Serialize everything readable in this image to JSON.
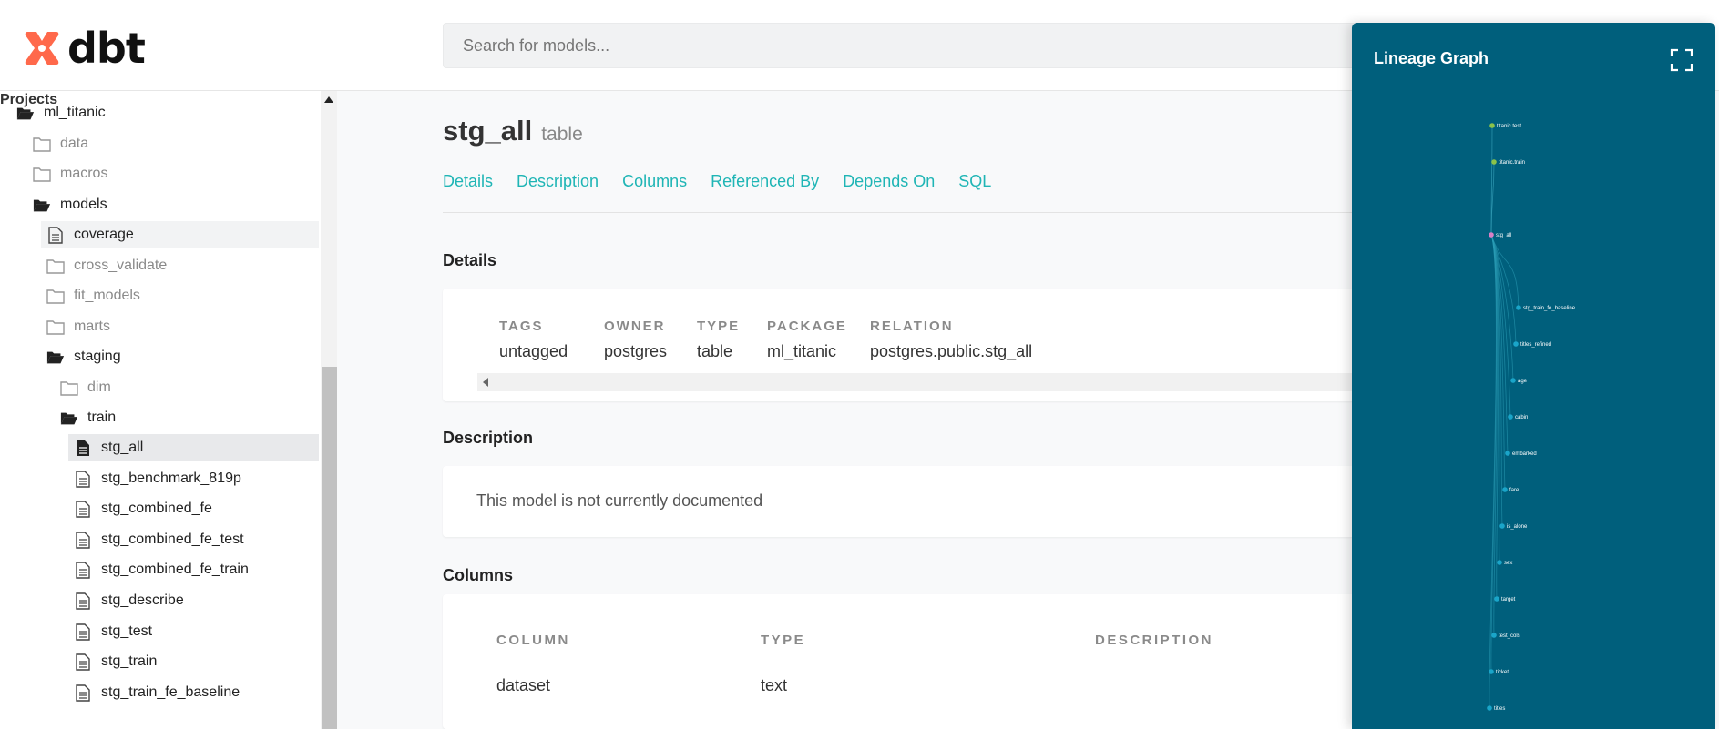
{
  "header": {
    "logo_text": "dbt",
    "search_placeholder": "Search for models..."
  },
  "sidebar": {
    "projects_title": "Projects",
    "items": [
      {
        "label": "ml_titanic",
        "icon": "folder-open-icon"
      },
      {
        "label": "data",
        "icon": "folder-icon"
      },
      {
        "label": "macros",
        "icon": "folder-icon"
      },
      {
        "label": "models",
        "icon": "folder-open-icon"
      },
      {
        "label": "coverage",
        "icon": "file-icon"
      },
      {
        "label": "cross_validate",
        "icon": "folder-icon"
      },
      {
        "label": "fit_models",
        "icon": "folder-icon"
      },
      {
        "label": "marts",
        "icon": "folder-icon"
      },
      {
        "label": "staging",
        "icon": "folder-open-icon"
      },
      {
        "label": "dim",
        "icon": "folder-icon"
      },
      {
        "label": "train",
        "icon": "folder-open-icon"
      },
      {
        "label": "stg_all",
        "icon": "file-filled-icon"
      },
      {
        "label": "stg_benchmark_819p",
        "icon": "file-icon"
      },
      {
        "label": "stg_combined_fe",
        "icon": "file-icon"
      },
      {
        "label": "stg_combined_fe_test",
        "icon": "file-icon"
      },
      {
        "label": "stg_combined_fe_train",
        "icon": "file-icon"
      },
      {
        "label": "stg_describe",
        "icon": "file-icon"
      },
      {
        "label": "stg_test",
        "icon": "file-icon"
      },
      {
        "label": "stg_train",
        "icon": "file-icon"
      },
      {
        "label": "stg_train_fe_baseline",
        "icon": "file-icon"
      }
    ]
  },
  "model": {
    "name": "stg_all",
    "type": "table"
  },
  "tabs": [
    "Details",
    "Description",
    "Columns",
    "Referenced By",
    "Depends On",
    "SQL"
  ],
  "details": {
    "heading": "Details",
    "fields": [
      {
        "label": "TAGS",
        "value": "untagged"
      },
      {
        "label": "OWNER",
        "value": "postgres"
      },
      {
        "label": "TYPE",
        "value": "table"
      },
      {
        "label": "PACKAGE",
        "value": "ml_titanic"
      },
      {
        "label": "RELATION",
        "value": "postgres.public.stg_all"
      }
    ]
  },
  "description": {
    "heading": "Description",
    "text": "This model is not currently documented"
  },
  "columns": {
    "heading": "Columns",
    "headers": [
      "COLUMN",
      "TYPE",
      "DESCRIPTION"
    ],
    "rows": [
      {
        "column": "dataset",
        "type": "text"
      }
    ]
  },
  "lineage": {
    "title": "Lineage Graph",
    "colors": {
      "background": "#005f7c",
      "source": "#8bc34a",
      "current": "#d980c6",
      "model": "#1aa5c9"
    },
    "nodes": [
      {
        "label": "titanic.test",
        "kind": "source"
      },
      {
        "label": "titanic.train",
        "kind": "source"
      },
      {
        "label": "stg_all",
        "kind": "current"
      },
      {
        "label": "stg_train_fe_baseline",
        "kind": "model"
      },
      {
        "label": "titles_refined",
        "kind": "model"
      },
      {
        "label": "age",
        "kind": "model"
      },
      {
        "label": "cabin",
        "kind": "model"
      },
      {
        "label": "embarked",
        "kind": "model"
      },
      {
        "label": "fare",
        "kind": "model"
      },
      {
        "label": "is_alone",
        "kind": "model"
      },
      {
        "label": "sex",
        "kind": "model"
      },
      {
        "label": "target",
        "kind": "model"
      },
      {
        "label": "test_cols",
        "kind": "model"
      },
      {
        "label": "ticket",
        "kind": "model"
      },
      {
        "label": "titles",
        "kind": "model"
      }
    ]
  }
}
